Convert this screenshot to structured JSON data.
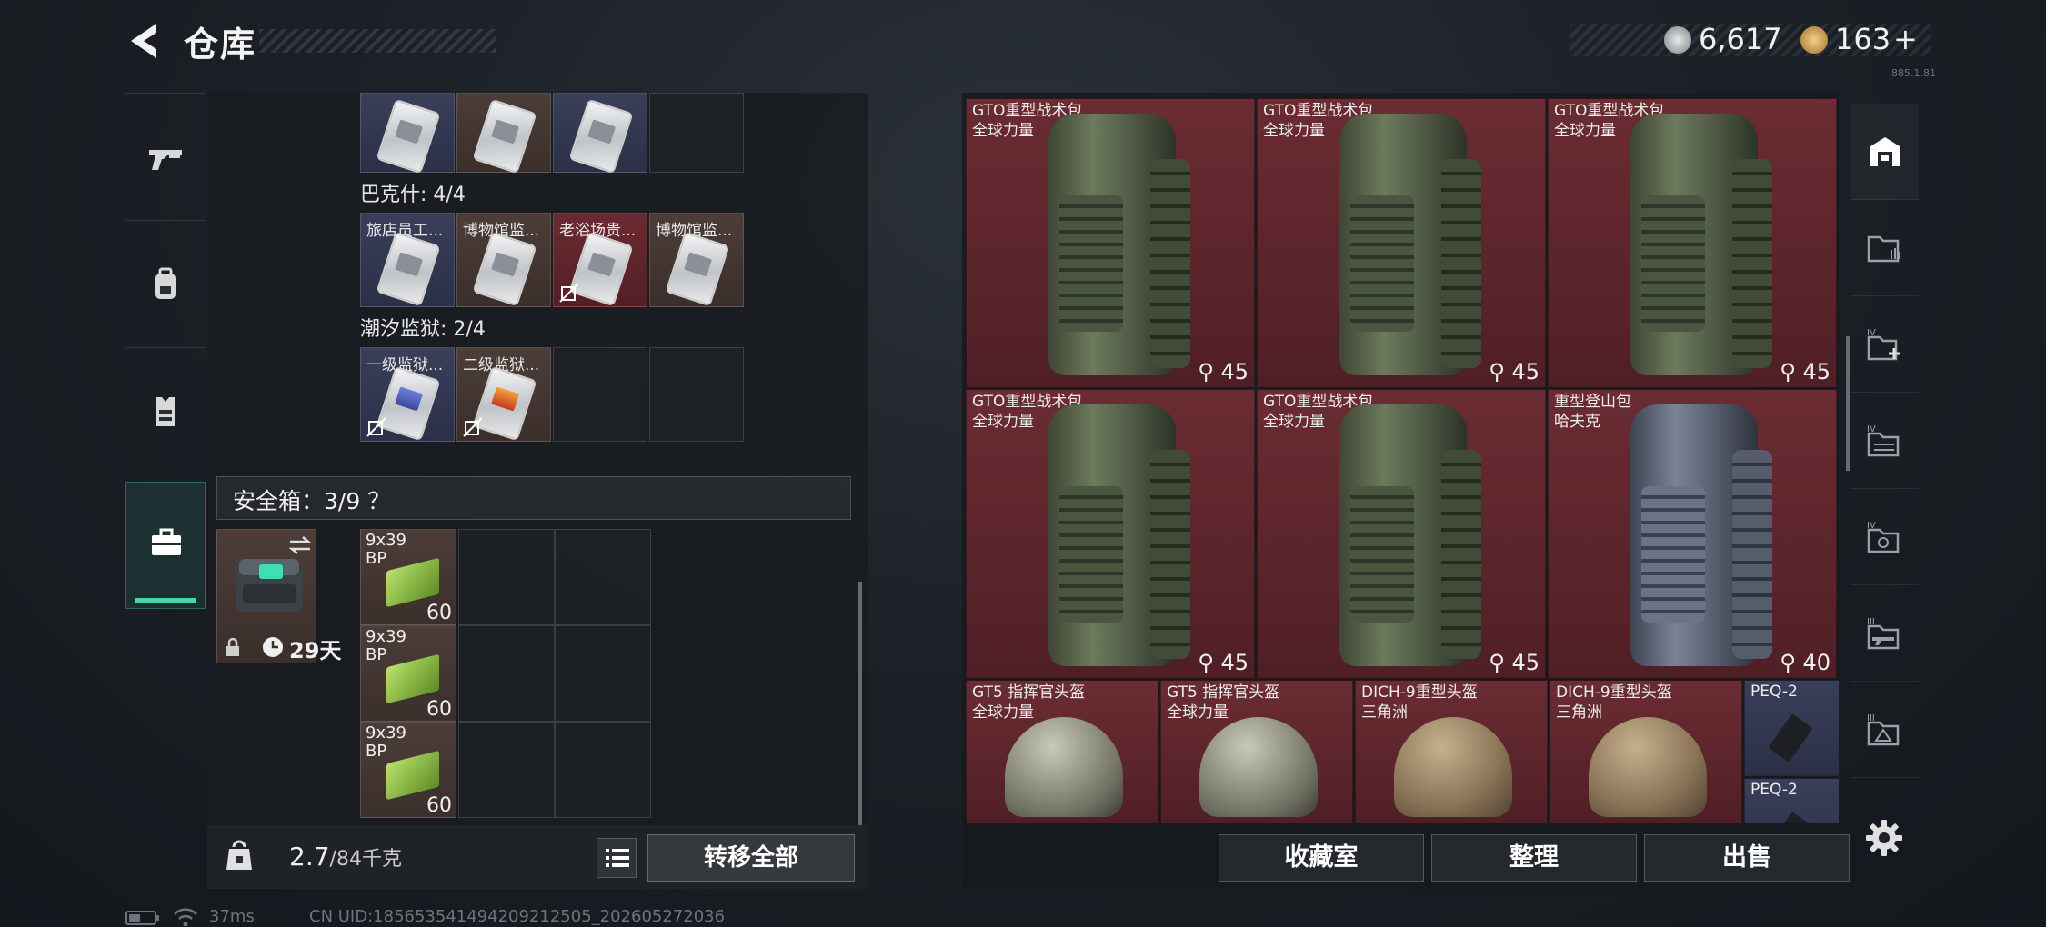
{
  "header": {
    "title": "仓库",
    "currency": [
      {
        "icon": "silver-coin-icon",
        "value": "6,617"
      },
      {
        "icon": "gold-coin-icon",
        "value": "163",
        "suffix": "+"
      }
    ],
    "small_code": "885.1.81"
  },
  "left_rail": {
    "tabs": [
      {
        "icon": "gun-icon",
        "active": false
      },
      {
        "icon": "backpack-icon",
        "active": false
      },
      {
        "icon": "vest-icon",
        "active": false
      },
      {
        "icon": "briefcase-icon",
        "active": true
      }
    ]
  },
  "inventory": {
    "groups": [
      {
        "title": "",
        "slots": [
          {
            "label": "",
            "color": "blue"
          },
          {
            "label": "",
            "color": "brown"
          },
          {
            "label": "",
            "color": "blue"
          },
          {
            "label": "",
            "color": "empty"
          }
        ]
      },
      {
        "title": "巴克什: 4/4",
        "slots": [
          {
            "label": "旅店员工...",
            "color": "blue",
            "locked": false
          },
          {
            "label": "博物馆监...",
            "color": "brown",
            "locked": false
          },
          {
            "label": "老浴场贵...",
            "color": "red",
            "locked": true
          },
          {
            "label": "博物馆监...",
            "color": "brown",
            "locked": false
          }
        ]
      },
      {
        "title": "潮汐监狱: 2/4",
        "slots": [
          {
            "label": "一级监狱...",
            "color": "blue",
            "locked": true
          },
          {
            "label": "二级监狱...",
            "color": "brown",
            "locked": true
          },
          {
            "label": "",
            "color": "empty"
          },
          {
            "label": "",
            "color": "empty"
          }
        ]
      }
    ],
    "safe": {
      "header": "安全箱：3/9 ？",
      "days": "29天",
      "ammo": [
        {
          "label": "9x39 BP",
          "qty": "60"
        },
        {
          "label": "9x39 BP",
          "qty": "60"
        },
        {
          "label": "9x39 BP",
          "qty": "60"
        }
      ]
    },
    "weight": {
      "value": "2.7",
      "capacity": "/84千克"
    },
    "transfer_all_label": "转移全部"
  },
  "stash": {
    "backpacks": [
      {
        "name": "GTO重型战术包",
        "faction": "全球力量",
        "capacity": "45",
        "variant": "green"
      },
      {
        "name": "GTO重型战术包",
        "faction": "全球力量",
        "capacity": "45",
        "variant": "green"
      },
      {
        "name": "GTO重型战术包",
        "faction": "全球力量",
        "capacity": "45",
        "variant": "green"
      },
      {
        "name": "GTO重型战术包",
        "faction": "全球力量",
        "capacity": "45",
        "variant": "green"
      },
      {
        "name": "GTO重型战术包",
        "faction": "全球力量",
        "capacity": "45",
        "variant": "green"
      },
      {
        "name": "重型登山包",
        "faction": "哈夫克",
        "capacity": "40",
        "variant": "grey"
      }
    ],
    "helmets": [
      {
        "name": "GT5 指挥官头盔",
        "faction": "全球力量",
        "variant": "grey"
      },
      {
        "name": "GT5 指挥官头盔",
        "faction": "全球力量",
        "variant": "grey"
      },
      {
        "name": "DICH-9重型头盔",
        "faction": "三角洲",
        "variant": "camo"
      },
      {
        "name": "DICH-9重型头盔",
        "faction": "三角洲",
        "variant": "camo"
      }
    ],
    "small_items": [
      {
        "name": "PEQ-2"
      },
      {
        "name": "PEQ-2"
      }
    ]
  },
  "right_rail": {
    "items": [
      {
        "icon": "home-stash-icon",
        "active": true
      },
      {
        "icon": "folder-bars-icon"
      },
      {
        "icon": "folder-add-icon",
        "tag": "IV"
      },
      {
        "icon": "folder-stack-icon",
        "tag": "IV"
      },
      {
        "icon": "folder-camera-icon",
        "tag": "IV"
      },
      {
        "icon": "folder-gun-icon",
        "tag": "III"
      },
      {
        "icon": "folder-warning-icon",
        "tag": "III"
      }
    ]
  },
  "bottom_buttons": {
    "collection": "收藏室",
    "sort": "整理",
    "sell": "出售"
  },
  "status": {
    "ping": "37ms",
    "uid": "CN UID:185653541494209212505_202605272036"
  }
}
